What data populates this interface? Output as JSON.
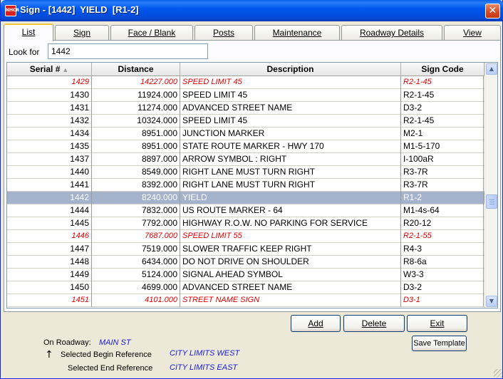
{
  "window": {
    "title": "Sign - [1442]  YIELD  [R1-2]",
    "app_icon": "NHCR"
  },
  "tabs": [
    {
      "label": "List",
      "active": true
    },
    {
      "label": "Sign"
    },
    {
      "label": "Face / Blank"
    },
    {
      "label": "Posts"
    },
    {
      "label": "Maintenance"
    },
    {
      "label": "Roadway Details"
    },
    {
      "label": "View"
    }
  ],
  "search": {
    "label": "Look for",
    "value": "1442"
  },
  "grid": {
    "columns": [
      "Serial #",
      "Distance",
      "Description",
      "Sign Code"
    ],
    "rows": [
      {
        "serial": "1429",
        "distance": "14227.000",
        "description": "SPEED LIMIT 45",
        "code": "R2-1-45",
        "style": "red"
      },
      {
        "serial": "1430",
        "distance": "11924.000",
        "description": "SPEED LIMIT 45",
        "code": "R2-1-45"
      },
      {
        "serial": "1431",
        "distance": "11274.000",
        "description": "ADVANCED STREET NAME",
        "code": "D3-2"
      },
      {
        "serial": "1432",
        "distance": "10324.000",
        "description": "SPEED LIMIT 45",
        "code": "R2-1-45"
      },
      {
        "serial": "1434",
        "distance": "8951.000",
        "description": "JUNCTION MARKER",
        "code": "M2-1"
      },
      {
        "serial": "1435",
        "distance": "8951.000",
        "description": "STATE ROUTE MARKER - HWY 170",
        "code": "M1-5-170"
      },
      {
        "serial": "1437",
        "distance": "8897.000",
        "description": "ARROW SYMBOL : RIGHT",
        "code": "I-100aR"
      },
      {
        "serial": "1440",
        "distance": "8549.000",
        "description": "RIGHT LANE MUST TURN RIGHT",
        "code": "R3-7R"
      },
      {
        "serial": "1441",
        "distance": "8392.000",
        "description": "RIGHT LANE MUST TURN RIGHT",
        "code": "R3-7R"
      },
      {
        "serial": "1442",
        "distance": "8240.000",
        "description": "YIELD",
        "code": "R1-2",
        "style": "selected"
      },
      {
        "serial": "1444",
        "distance": "7832.000",
        "description": "US ROUTE MARKER - 64",
        "code": "M1-4s-64"
      },
      {
        "serial": "1445",
        "distance": "7792.000",
        "description": "HIGHWAY R.O.W. NO PARKING FOR SERVICE",
        "code": "R20-12"
      },
      {
        "serial": "1446",
        "distance": "7687.000",
        "description": "SPEED LIMIT 55",
        "code": "R2-1-55",
        "style": "red"
      },
      {
        "serial": "1447",
        "distance": "7519.000",
        "description": "SLOWER TRAFFIC KEEP RIGHT",
        "code": "R4-3"
      },
      {
        "serial": "1448",
        "distance": "6434.000",
        "description": "DO NOT DRIVE ON SHOULDER",
        "code": "R8-6a"
      },
      {
        "serial": "1449",
        "distance": "5124.000",
        "description": "SIGNAL AHEAD SYMBOL",
        "code": "W3-3"
      },
      {
        "serial": "1450",
        "distance": "4699.000",
        "description": "ADVANCED STREET NAME",
        "code": "D3-2"
      },
      {
        "serial": "1451",
        "distance": "4101.000",
        "description": "STREET NAME SIGN",
        "code": "D3-1",
        "style": "red"
      }
    ]
  },
  "buttons": {
    "add": "Add",
    "delete": "Delete",
    "exit": "Exit",
    "save_template": "Save Template"
  },
  "info": {
    "roadway_label": "On Roadway:",
    "roadway_value": "MAIN ST",
    "begin_label": "Selected Begin Reference",
    "begin_value": "CITY LIMITS WEST",
    "end_label": "Selected End Reference",
    "end_value": "CITY LIMITS EAST"
  },
  "colors": {
    "title_bar": "#0058ee",
    "selection": "#a5b2cb",
    "alert_text": "#e00000",
    "info_value": "#1a1ad0"
  }
}
